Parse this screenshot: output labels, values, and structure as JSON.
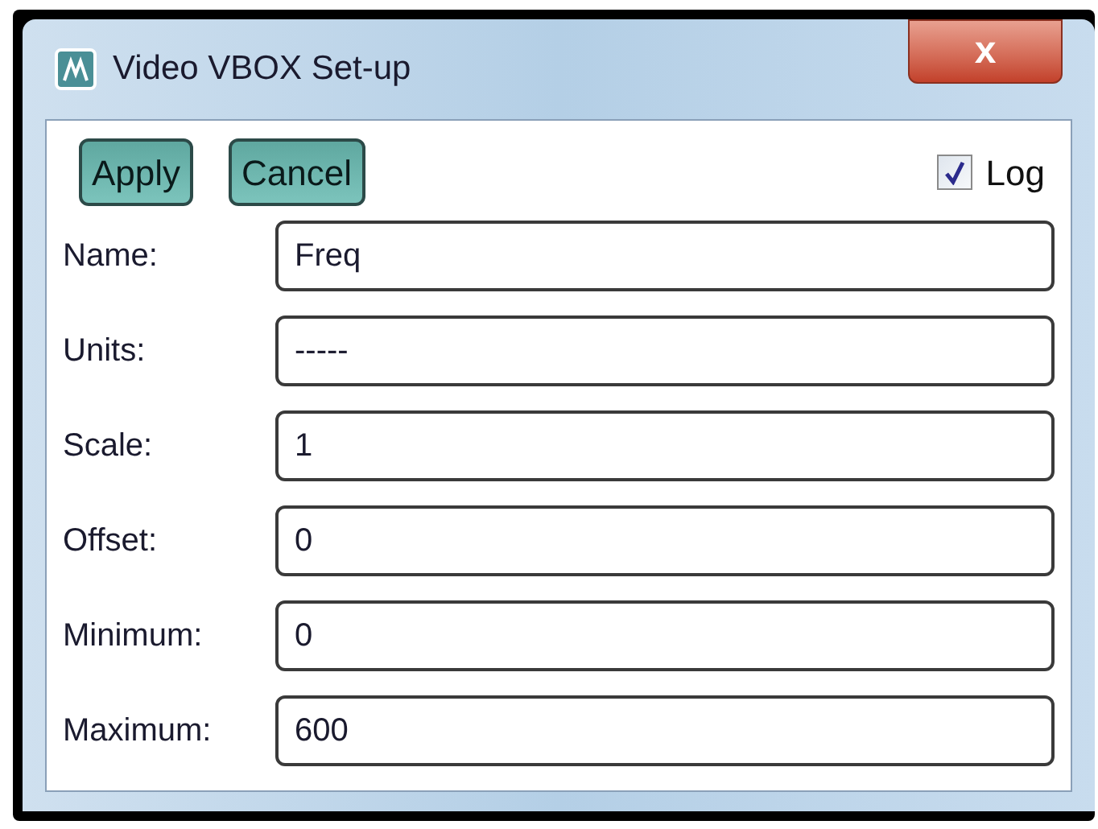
{
  "window": {
    "title": "Video VBOX Set-up",
    "close": "x"
  },
  "buttons": [
    "Apply",
    "Cancel"
  ],
  "log": {
    "label": "Log",
    "checked": true
  },
  "fields": [
    {
      "label": "Name:",
      "value": "Freq"
    },
    {
      "label": "Units:",
      "value": "-----"
    },
    {
      "label": "Scale:",
      "value": "1"
    },
    {
      "label": "Offset:",
      "value": "0"
    },
    {
      "label": "Minimum:",
      "value": "0"
    },
    {
      "label": "Maximum:",
      "value": "600"
    }
  ]
}
